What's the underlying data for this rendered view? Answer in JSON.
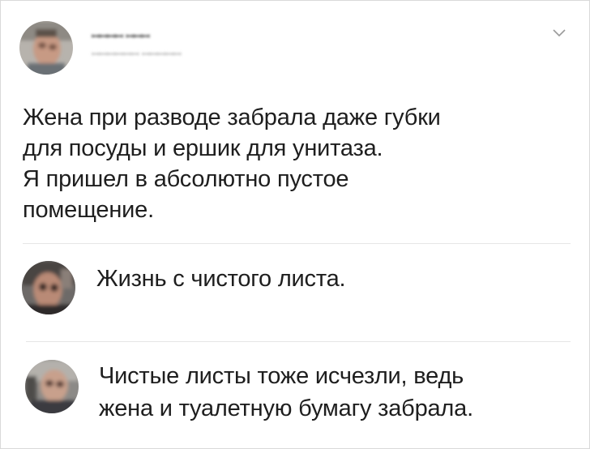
{
  "post": {
    "author_name": "ꟷꟷꟷꟷ ꟷꟷꟷ",
    "author_handle": "ꟷꟷꟷꟷꟷꟷ ꟷꟷꟷꟷꟷ",
    "avatar_icon": "user-avatar-icon",
    "menu_icon": "chevron-down-icon",
    "text_lines": [
      "Жена при разводе забрала даже губки",
      "для посуды и ершик для унитаза.",
      "Я пришел в абсолютно пустое",
      "помещение."
    ]
  },
  "comments": [
    {
      "avatar_icon": "user-avatar-icon",
      "text_lines": [
        "Жизнь с чистого листа."
      ]
    },
    {
      "avatar_icon": "user-avatar-icon",
      "text_lines": [
        "Чистые листы тоже исчезли, ведь",
        "жена и туалетную бумагу забрала."
      ]
    }
  ],
  "colors": {
    "text": "#1e1e1e",
    "divider": "#e6e6e6",
    "border": "#d9d9d9",
    "chevron": "#9a9a9a"
  }
}
